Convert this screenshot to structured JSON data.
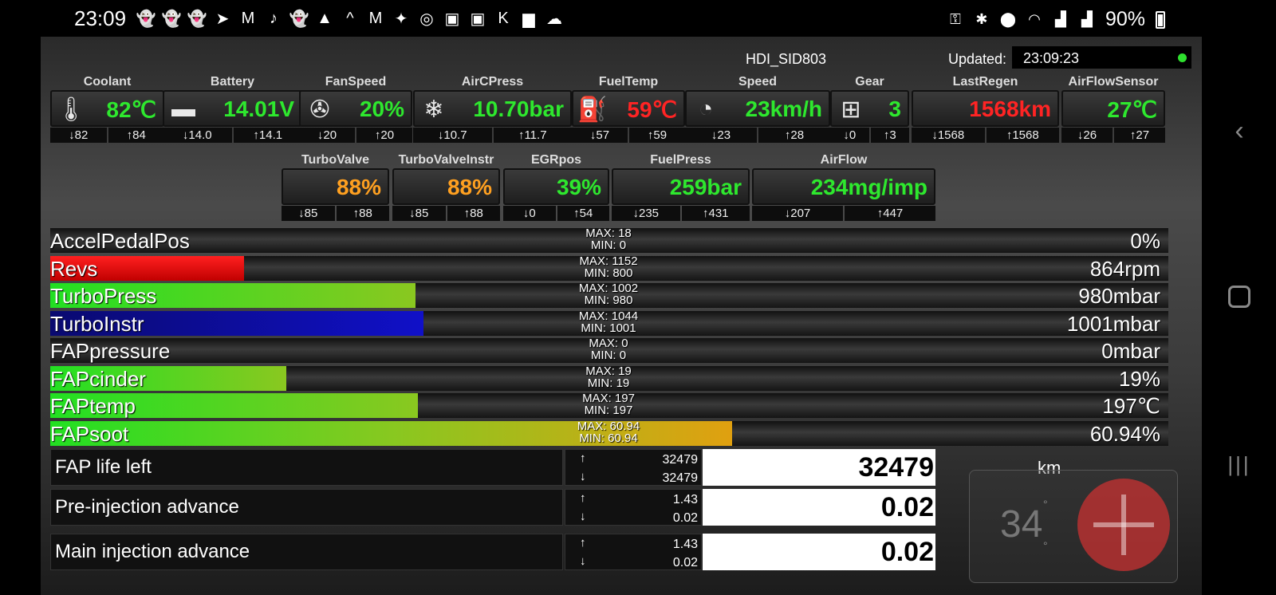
{
  "status_bar": {
    "time": "23:09",
    "battery": "90%",
    "notification_icons": [
      "snapchat-icon",
      "snapchat-icon",
      "snapchat-icon",
      "telegram-icon",
      "gmail-icon",
      "tiktok-icon",
      "snapchat-icon",
      "cake-icon",
      "citroen-icon",
      "gmail-icon",
      "twitter-icon",
      "instagram-icon",
      "twitch-icon",
      "twitch-icon",
      "kik-icon",
      "shopping-bag-icon",
      "cloud-icon"
    ],
    "system_icons": [
      "key-icon",
      "bluetooth-icon",
      "location-icon",
      "wifi-icon",
      "signal-icon",
      "signal-icon"
    ]
  },
  "header": {
    "device": "HDI_SID803",
    "updated_label": "Updated:",
    "updated_time": "23:09:23"
  },
  "gauges_row1": [
    {
      "title": "Coolant",
      "icon": "coolant-temp-icon",
      "value": "82℃",
      "color": "#2ee82e",
      "min": "82",
      "max": "84"
    },
    {
      "title": "Battery",
      "icon": "battery-icon",
      "value": "14.01V",
      "color": "#2ee82e",
      "min": "14.0",
      "max": "14.1"
    },
    {
      "title": "FanSpeed",
      "icon": "fan-icon",
      "value": "20%",
      "color": "#2ee82e",
      "min": "20",
      "max": "20"
    },
    {
      "title": "AirCPress",
      "icon": "snowflake-icon",
      "value": "10.70bar",
      "color": "#2ee82e",
      "min": "10.7",
      "max": "11.7"
    },
    {
      "title": "FuelTemp",
      "icon": "fuel-temp-icon",
      "value": "59℃",
      "color": "#ff2424",
      "min": "57",
      "max": "59"
    },
    {
      "title": "Speed",
      "icon": "speedometer-icon",
      "value": "23km/h",
      "color": "#2ee82e",
      "min": "23",
      "max": "28"
    },
    {
      "title": "Gear",
      "icon": "gearshift-icon",
      "value": "3",
      "color": "#2ee82e",
      "min": "0",
      "max": "3"
    },
    {
      "title": "LastRegen",
      "icon": "",
      "value": "1568km",
      "color": "#ff2424",
      "min": "1568",
      "max": "1568"
    },
    {
      "title": "AirFlowSensor",
      "icon": "",
      "value": "27℃",
      "color": "#2ee82e",
      "min": "26",
      "max": "27"
    }
  ],
  "gauges_row2": [
    {
      "title": "TurboValve",
      "value": "88%",
      "color": "#ffa020",
      "min": "85",
      "max": "88"
    },
    {
      "title": "TurboValveInstr",
      "value": "88%",
      "color": "#ffa020",
      "min": "85",
      "max": "88"
    },
    {
      "title": "EGRpos",
      "value": "39%",
      "color": "#2ee82e",
      "min": "0",
      "max": "54"
    },
    {
      "title": "FuelPress",
      "value": "259bar",
      "color": "#2ee82e",
      "min": "235",
      "max": "431"
    },
    {
      "title": "AirFlow",
      "value": "234mg/imp",
      "color": "#2ee82e",
      "min": "207",
      "max": "447"
    }
  ],
  "bars": [
    {
      "label": "AccelPedalPos",
      "value": "0%",
      "max": "MAX: 18",
      "min": "MIN: 0",
      "fill": 0.0,
      "colors": "none"
    },
    {
      "label": "Revs",
      "value": "864rpm",
      "max": "MAX: 1152",
      "min": "MIN: 800",
      "fill": 0.173,
      "colors": "red"
    },
    {
      "label": "TurboPress",
      "value": "980mbar",
      "max": "MAX: 1002",
      "min": "MIN: 980",
      "fill": 0.327,
      "colors": "green"
    },
    {
      "label": "TurboInstr",
      "value": "1001mbar",
      "max": "MAX: 1044",
      "min": "MIN: 1001",
      "fill": 0.334,
      "colors": "blue"
    },
    {
      "label": "FAPpressure",
      "value": "0mbar",
      "max": "MAX: 0",
      "min": "MIN: 0",
      "fill": 0.0,
      "colors": "none"
    },
    {
      "label": "FAPcinder",
      "value": "19%",
      "max": "MAX: 19",
      "min": "MIN: 19",
      "fill": 0.211,
      "colors": "green"
    },
    {
      "label": "FAPtemp",
      "value": "197℃",
      "max": "MAX: 197",
      "min": "MIN: 197",
      "fill": 0.329,
      "colors": "green"
    },
    {
      "label": "FAPsoot",
      "value": "60.94%",
      "max": "MAX: 60.94",
      "min": "MIN: 60.94",
      "fill": 0.61,
      "colors": "green-yellow"
    }
  ],
  "params": [
    {
      "name": "FAP life left",
      "up": "32479",
      "down": "32479",
      "value": "32479"
    },
    {
      "name": "Pre-injection advance",
      "up": "1.43",
      "down": "0.02",
      "value": "0.02"
    },
    {
      "name": "Main injection advance",
      "up": "1.43",
      "down": "0.02",
      "value": "0.02"
    }
  ],
  "unit": "km",
  "overlay": {
    "temp": "34"
  },
  "colors": {
    "green": "#2ee82e",
    "red": "#ff2424",
    "orange": "#ffa020",
    "blue": "#0a0aa0"
  }
}
